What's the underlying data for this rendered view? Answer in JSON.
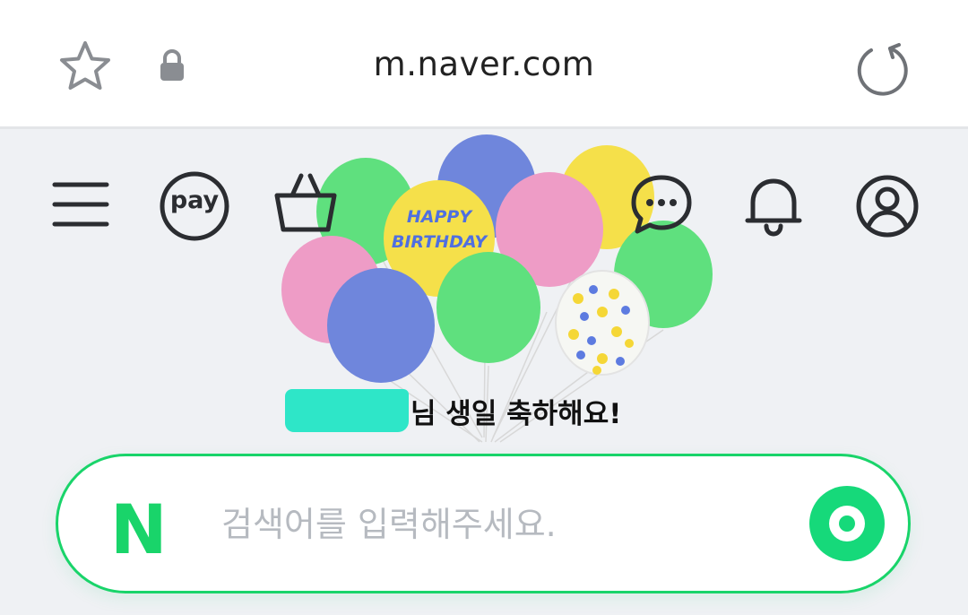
{
  "browser": {
    "url": "m.naver.com",
    "icons": [
      "star-icon",
      "lock-icon",
      "reload-icon"
    ]
  },
  "nav": {
    "icons": [
      "menu-icon",
      "pay-icon",
      "shopping-bag-icon",
      "chat-icon",
      "bell-icon",
      "profile-icon"
    ],
    "pay_label": "pay"
  },
  "birthday": {
    "message": "님 생일 축하해요!",
    "balloon_text_1": "HAPPY",
    "balloon_text_2": "BIRTHDAY"
  },
  "search": {
    "logo": "N",
    "placeholder": "검색어를 입력해주세요."
  },
  "colors": {
    "brand_green": "#19d46a",
    "page_bg": "#eff1f4",
    "redaction": "#2ee6c8",
    "balloon_green": "#5fe07e",
    "balloon_blue": "#6f86dc",
    "balloon_pink": "#ee9cc6",
    "balloon_yellow": "#f5e04a"
  }
}
